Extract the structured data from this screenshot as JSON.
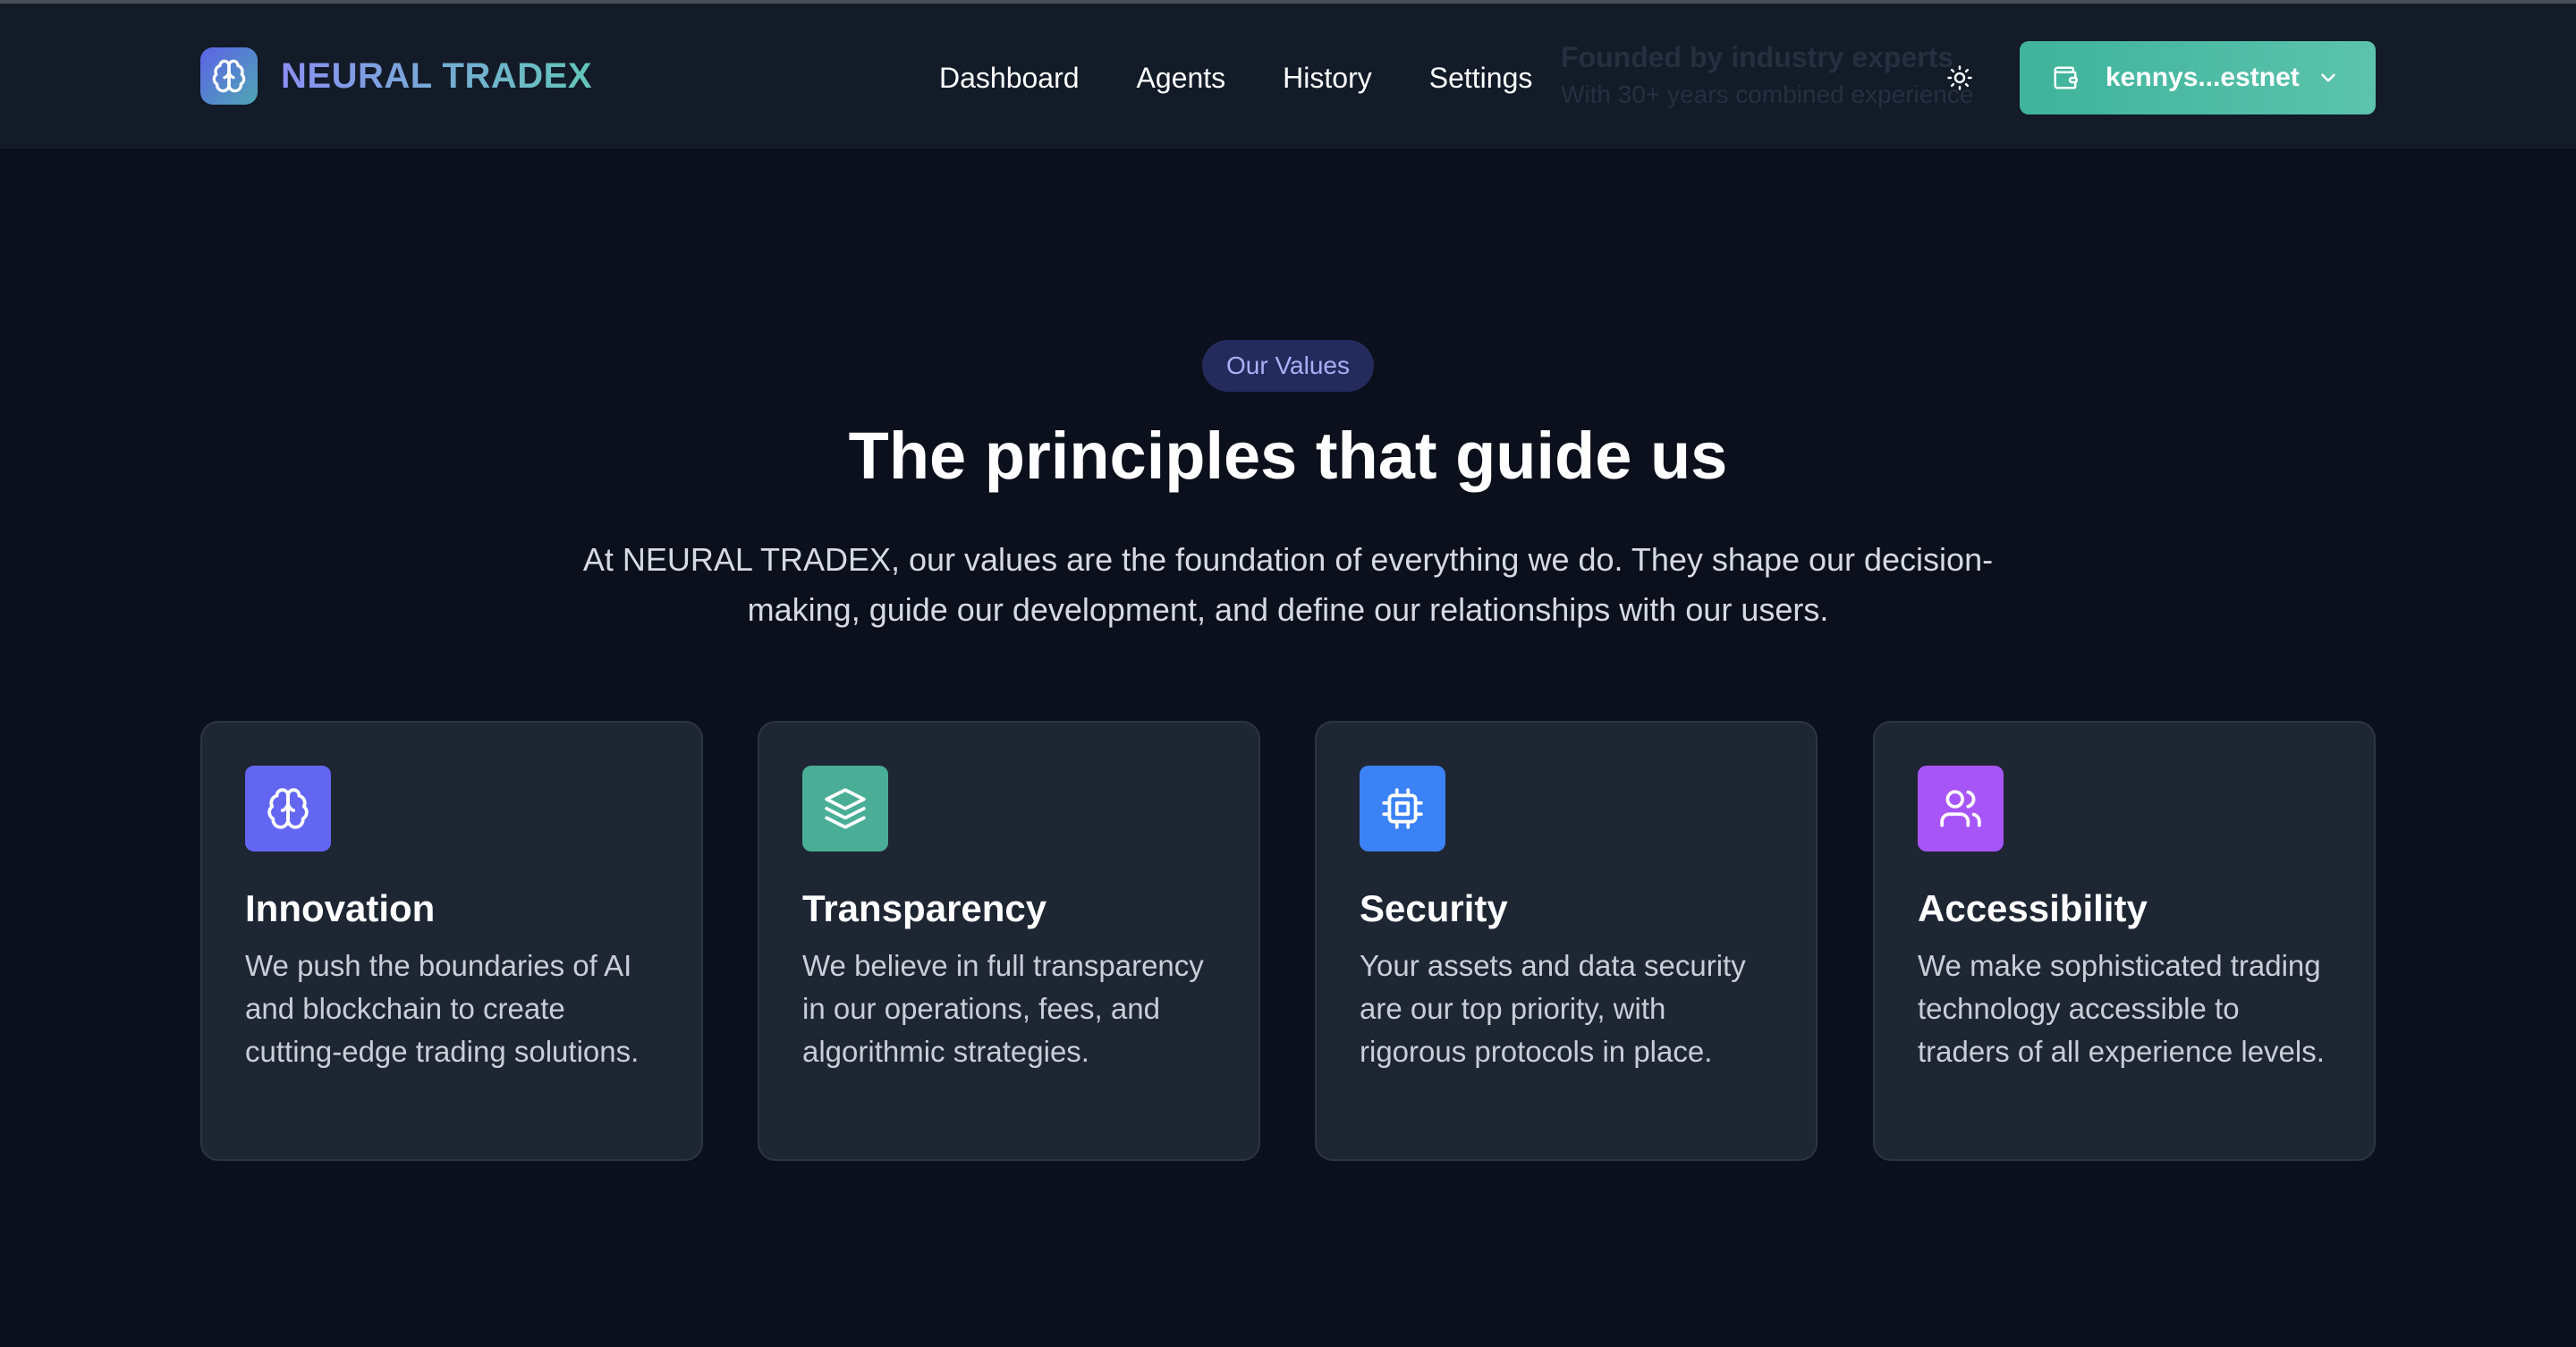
{
  "header": {
    "brand_name": "NEURAL TRADEX",
    "ghost_title": "Founded by industry experts",
    "ghost_subtitle": "With 30+ years combined experience",
    "nav": [
      "Dashboard",
      "Agents",
      "History",
      "Settings"
    ],
    "wallet_label": "kennys...estnet",
    "icons": {
      "logo": "brain-icon",
      "theme": "sun-icon",
      "wallet": "wallet-icon",
      "dropdown": "chevron-down-icon"
    }
  },
  "hero": {
    "badge": "Our Values",
    "headline": "The principles that guide us",
    "subtext": "At NEURAL TRADEX, our values are the foundation of everything we do. They shape our decision-making, guide our development, and define our relationships with our users."
  },
  "values": [
    {
      "title": "Innovation",
      "description": "We push the boundaries of AI and blockchain to create cutting-edge trading solutions.",
      "icon": "brain-icon",
      "color": "#6366f1"
    },
    {
      "title": "Transparency",
      "description": "We believe in full transparency in our operations, fees, and algorithmic strategies.",
      "icon": "layers-icon",
      "color": "#4aae96"
    },
    {
      "title": "Security",
      "description": "Your assets and data security are our top priority, with rigorous protocols in place.",
      "icon": "chip-icon",
      "color": "#3b82f6"
    },
    {
      "title": "Accessibility",
      "description": "We make sophisticated trading technology accessible to traders of all experience levels.",
      "icon": "users-icon",
      "color": "#a855f7"
    }
  ]
}
